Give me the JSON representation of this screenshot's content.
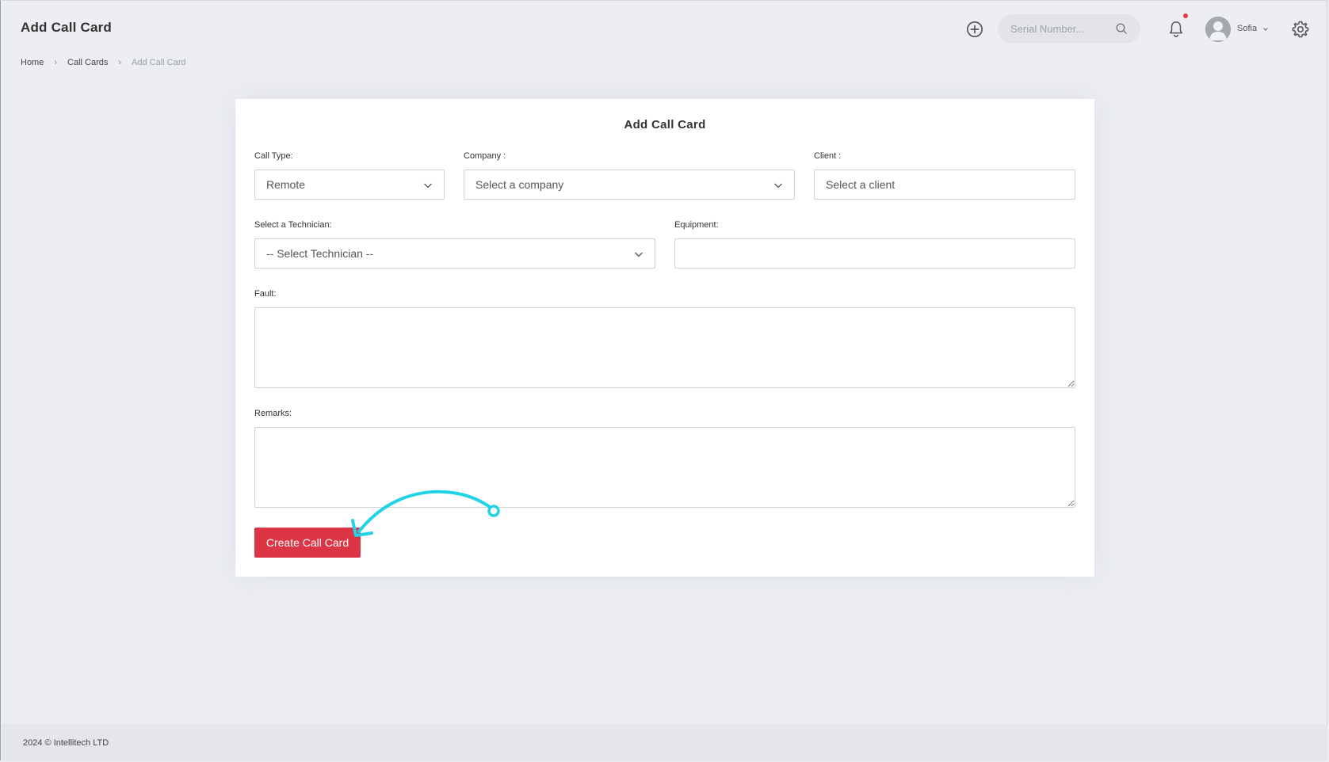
{
  "header": {
    "title": "Add Call Card",
    "search": {
      "placeholder": "Serial Number..."
    },
    "user": {
      "name": "Sofia"
    },
    "icons": {
      "add": "plus-circle-icon",
      "search": "search-icon",
      "notifications": "bell-icon",
      "settings": "gear-icon"
    },
    "notification_dot_color": "#e53945"
  },
  "breadcrumb": {
    "items": [
      "Home",
      "Call Cards",
      "Add Call Card"
    ]
  },
  "form": {
    "title": "Add Call Card",
    "call_type": {
      "label": "Call Type:",
      "value": "Remote"
    },
    "company": {
      "label": "Company :",
      "value": "Select a company"
    },
    "client": {
      "label": "Client :",
      "placeholder": "Select a client"
    },
    "technician": {
      "label": "Select a Technician:",
      "value": "-- Select Technician --"
    },
    "equipment": {
      "label": "Equipment:",
      "value": ""
    },
    "fault": {
      "label": "Fault:",
      "value": ""
    },
    "remarks": {
      "label": "Remarks:",
      "value": ""
    },
    "submit_label": "Create Call Card",
    "submit_color": "#dc3545"
  },
  "annotation": {
    "color": "#22d3e6",
    "icon": "curved-arrow-icon"
  },
  "footer": {
    "text": "2024 © Intellitech LTD"
  }
}
